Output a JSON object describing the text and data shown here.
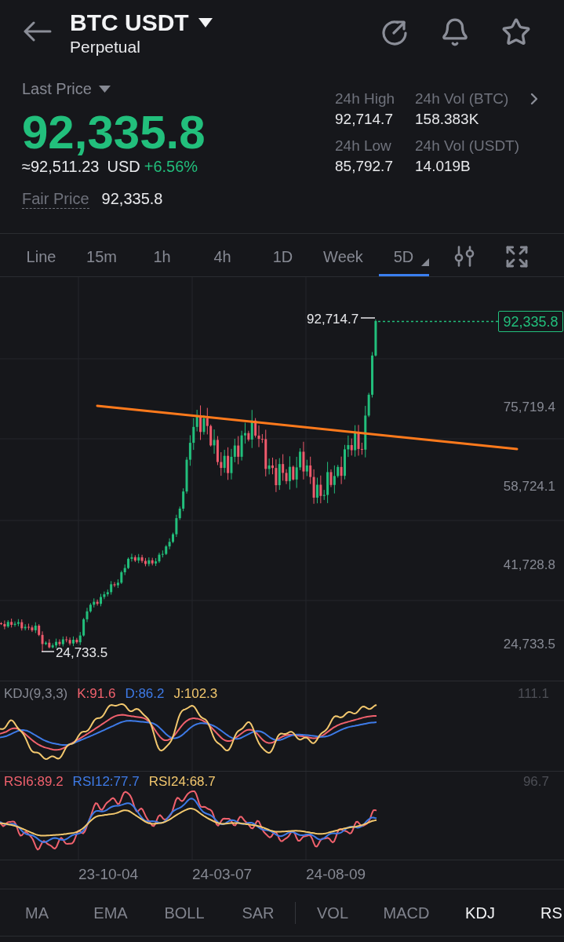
{
  "header": {
    "title": "BTC USDT",
    "subtitle": "Perpetual"
  },
  "price": {
    "label": "Last Price",
    "last": "92,335.8",
    "approx": "≈92,511.23",
    "currency": "USD",
    "change": "+6.56%",
    "fair_label": "Fair Price",
    "fair_value": "92,335.8"
  },
  "stats": [
    {
      "label": "24h High",
      "value": "92,714.7"
    },
    {
      "label": "24h Vol (BTC)",
      "value": "158.383K"
    },
    {
      "label": "24h Low",
      "value": "85,792.7"
    },
    {
      "label": "24h Vol (USDT)",
      "value": "14.019B"
    }
  ],
  "timeframes": [
    {
      "label": "Line",
      "kind": "option",
      "selected": false
    },
    {
      "label": "15m",
      "kind": "option",
      "selected": false
    },
    {
      "label": "1h",
      "kind": "option",
      "selected": false
    },
    {
      "label": "4h",
      "kind": "option",
      "selected": false
    },
    {
      "label": "1D",
      "kind": "option",
      "selected": false
    },
    {
      "label": "Week",
      "kind": "option",
      "selected": false
    },
    {
      "label": "5D",
      "kind": "menu",
      "selected": true
    }
  ],
  "chart": {
    "high_label": "92,714.7",
    "low_label": "24,733.5",
    "last_price_tag": "92,335.8",
    "y_axis_labels": [
      "75,719.4",
      "58,724.1",
      "41,728.8",
      "24,733.5"
    ]
  },
  "kdj": {
    "name": "KDJ(9,3,3)",
    "scale_label": "111.1",
    "series": [
      {
        "label": "K:91.6",
        "color": "#f0616d"
      },
      {
        "label": "D:86.2",
        "color": "#3e7be8"
      },
      {
        "label": "J:102.3",
        "color": "#f3c86e"
      }
    ]
  },
  "rsi": {
    "scale_label": "96.7",
    "series": [
      {
        "label": "RSI6:89.2",
        "color": "#f0616d"
      },
      {
        "label": "RSI12:77.7",
        "color": "#3e7be8"
      },
      {
        "label": "RSI24:68.7",
        "color": "#f3c86e"
      }
    ]
  },
  "x_axis_labels": [
    "23-10-04",
    "24-03-07",
    "24-08-09"
  ],
  "indicator_tabs": {
    "main": [
      {
        "label": "MA",
        "selected": false
      },
      {
        "label": "EMA",
        "selected": false
      },
      {
        "label": "BOLL",
        "selected": false
      },
      {
        "label": "SAR",
        "selected": false
      }
    ],
    "sub": [
      {
        "label": "VOL",
        "selected": false
      },
      {
        "label": "MACD",
        "selected": false
      },
      {
        "label": "KDJ",
        "selected": true
      },
      {
        "label": "RS",
        "selected": true
      }
    ]
  }
}
